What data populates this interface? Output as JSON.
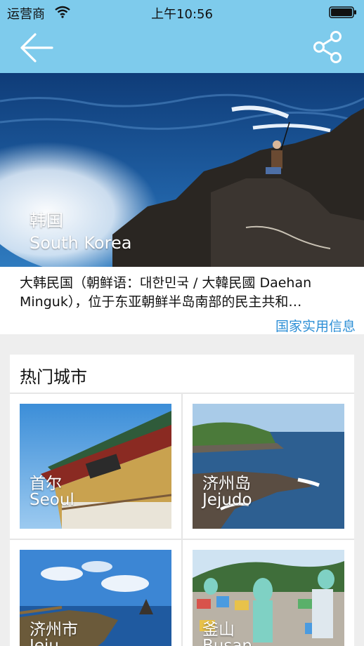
{
  "status_bar": {
    "carrier": "运营商",
    "time": "上午10:56"
  },
  "nav": {
    "back_icon": "back-arrow-icon",
    "share_icon": "share-icon"
  },
  "hero": {
    "title": "韩国",
    "subtitle": "South Korea"
  },
  "intro": {
    "text": "大韩民国（朝鲜语：대한민국 / 大韓民國 Daehan Minguk），位于东亚朝鲜半岛南部的民主共和…",
    "link_label": "国家实用信息"
  },
  "hot_cities": {
    "title": "热门城市",
    "items": [
      {
        "name": "首尔",
        "en": "Seoul"
      },
      {
        "name": "济州岛",
        "en": "Jejudo"
      },
      {
        "name": "济州市",
        "en": "Jeju"
      },
      {
        "name": "釜山",
        "en": "Busan"
      }
    ]
  },
  "colors": {
    "header": "#7ecbec",
    "link": "#2d8fd6",
    "background": "#eeeeee"
  }
}
